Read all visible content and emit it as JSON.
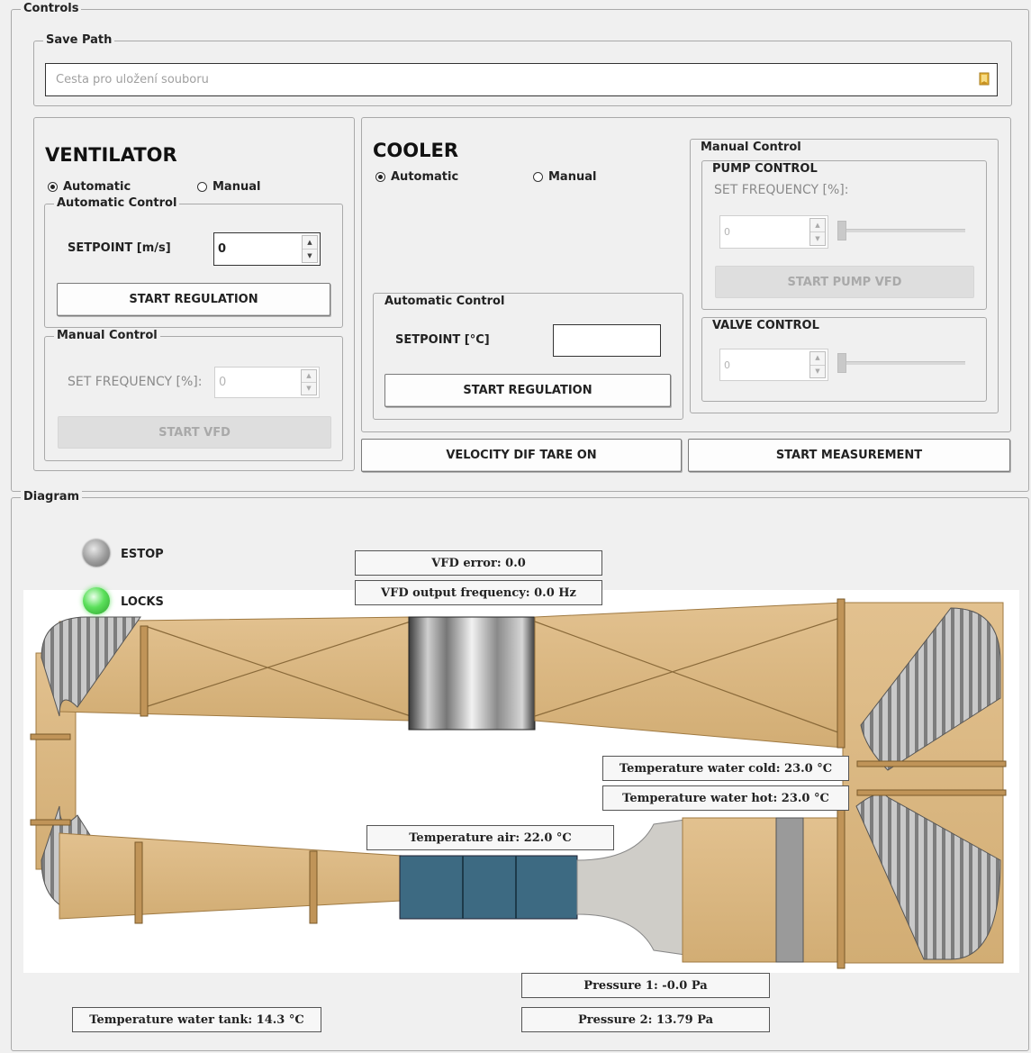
{
  "controls": {
    "title": "Controls",
    "save_path": {
      "legend": "Save Path",
      "placeholder": "Cesta pro uložení souboru",
      "browse_icon": "folder-icon"
    },
    "ventilator": {
      "heading": "VENTILATOR",
      "mode_automatic": "Automatic",
      "mode_manual": "Manual",
      "selected_mode": "Automatic",
      "auto": {
        "legend": "Automatic Control",
        "setpoint_label": "SETPOINT [m/s]",
        "setpoint_value": "0",
        "start_button": "START REGULATION"
      },
      "manual": {
        "legend": "Manual Control",
        "freq_label": "SET FREQUENCY [%]:",
        "freq_value": "0",
        "start_button": "START VFD"
      }
    },
    "cooler": {
      "heading": "COOLER",
      "mode_automatic": "Automatic",
      "mode_manual": "Manual",
      "selected_mode": "Automatic",
      "auto": {
        "legend": "Automatic Control",
        "setpoint_label": "SETPOINT [°C]",
        "setpoint_value": "",
        "start_button": "START REGULATION"
      },
      "manual": {
        "legend": "Manual Control",
        "pump": {
          "legend": "PUMP CONTROL",
          "freq_label": "SET FREQUENCY [%]:",
          "value": "0",
          "slider_level": 0,
          "start_button": "START PUMP VFD"
        },
        "valve": {
          "legend": "VALVE CONTROL",
          "value": "0",
          "slider_level": 0
        }
      }
    },
    "tare_button": "VELOCITY DIF TARE ON",
    "measure_button": "START MEASUREMENT"
  },
  "diagram": {
    "title": "Diagram",
    "estop": {
      "label": "ESTOP",
      "state": "off",
      "color": "#8f8f8f"
    },
    "locks": {
      "label": "LOCKS",
      "state": "on",
      "color": "#4cd64c"
    },
    "readouts": {
      "vfd_error": "VFD error: 0.0",
      "vfd_freq": "VFD output frequency: 0.0 Hz",
      "water_cold": "Temperature water cold: 23.0 °C",
      "water_hot": "Temperature water hot: 23.0 °C",
      "air": "Temperature air: 22.0 °C",
      "pressure1": "Pressure 1: -0.0 Pa",
      "pressure2": "Pressure 2: 13.79 Pa",
      "water_tank": "Temperature water tank: 14.3 °C"
    }
  },
  "colors": {
    "wood": "#dcb985",
    "wood_dark": "#b98f52",
    "duct_metal": "#c9c9c9",
    "heat_exchanger": "#3d6a82"
  }
}
